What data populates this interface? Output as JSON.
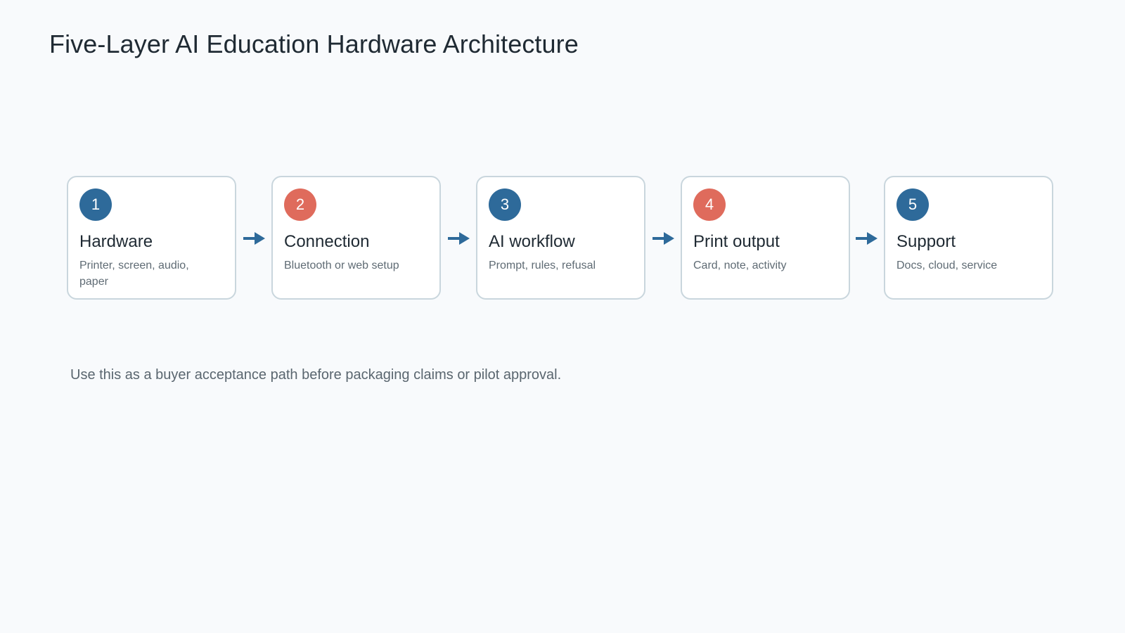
{
  "title": "Five-Layer AI Education Hardware Architecture",
  "colors": {
    "blue": "#2e6a9a",
    "coral": "#df6b5c",
    "arrow": "#2e6a9a"
  },
  "layers": [
    {
      "number": "1",
      "title": "Hardware",
      "description": "Printer, screen, audio, paper",
      "badge_color": "#2e6a9a"
    },
    {
      "number": "2",
      "title": "Connection",
      "description": "Bluetooth or web setup",
      "badge_color": "#df6b5c"
    },
    {
      "number": "3",
      "title": "AI workflow",
      "description": "Prompt, rules, refusal",
      "badge_color": "#2e6a9a"
    },
    {
      "number": "4",
      "title": "Print output",
      "description": "Card, note, activity",
      "badge_color": "#df6b5c"
    },
    {
      "number": "5",
      "title": "Support",
      "description": "Docs, cloud, service",
      "badge_color": "#2e6a9a"
    }
  ],
  "arrow_icon": "right-arrow-icon",
  "note": "Use this as a buyer acceptance path before packaging claims or pilot approval."
}
